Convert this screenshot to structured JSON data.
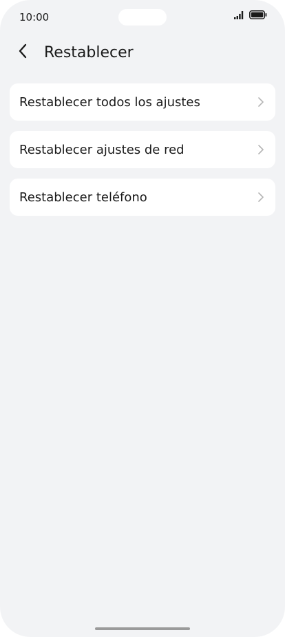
{
  "status_bar": {
    "time": "10:00",
    "icons": [
      "signal-icon",
      "battery-icon"
    ]
  },
  "header": {
    "back_icon": "chevron-left-icon",
    "title": "Restablecer"
  },
  "items": [
    {
      "label": "Restablecer todos los ajustes",
      "icon": "chevron-right-icon"
    },
    {
      "label": "Restablecer ajustes de red",
      "icon": "chevron-right-icon"
    },
    {
      "label": "Restablecer teléfono",
      "icon": "chevron-right-icon"
    }
  ],
  "colors": {
    "background": "#f2f3f5",
    "card": "#ffffff",
    "text": "#1a1a1a",
    "chevron": "#b5b5b5"
  }
}
